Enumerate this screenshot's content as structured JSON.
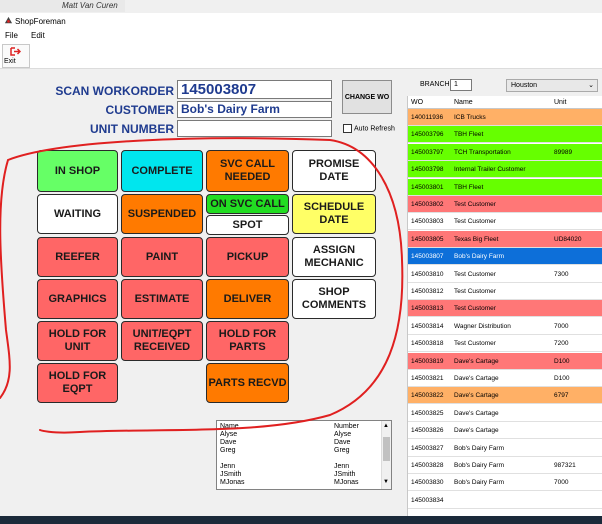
{
  "top_name": "Matt Van Curen",
  "app_title": "ShopForeman",
  "menu": [
    "File",
    "Edit"
  ],
  "toolbar": {
    "exit_label": "Exit"
  },
  "form": {
    "workorder_label": "SCAN WORKORDER",
    "workorder_value": "145003807",
    "customer_label": "CUSTOMER",
    "customer_value": "Bob's Dairy Farm",
    "unit_label": "UNIT NUMBER",
    "unit_value": "",
    "change_wo_label": "CHANGE WO",
    "auto_refresh_label": "Auto Refresh"
  },
  "buttons": {
    "in_shop": "IN SHOP",
    "complete": "COMPLETE",
    "svc_call_needed": "SVC CALL NEEDED",
    "promise_date": "PROMISE DATE",
    "waiting": "WAITING",
    "suspended": "SUSPENDED",
    "on_svc_call": "ON SVC CALL",
    "spot": "SPOT",
    "schedule_date": "SCHEDULE DATE",
    "reefer": "REEFER",
    "paint": "PAINT",
    "pickup": "PICKUP",
    "assign_mechanic": "ASSIGN MECHANIC",
    "graphics": "GRAPHICS",
    "estimate": "ESTIMATE",
    "deliver": "DELIVER",
    "shop_comments": "SHOP COMMENTS",
    "hold_for_unit": "HOLD FOR UNIT",
    "unit_eqpt_received": "UNIT/EQPT RECEIVED",
    "hold_for_parts": "HOLD FOR PARTS",
    "hold_for_eqpt": "HOLD FOR EQPT",
    "parts_recvd": "PARTS RECVD"
  },
  "user_list": {
    "headers": [
      "Name",
      "Number"
    ],
    "rows": [
      [
        "Alyse",
        "Alyse"
      ],
      [
        "Dave",
        "Dave"
      ],
      [
        "Greg",
        "Greg"
      ],
      [
        "",
        ""
      ],
      [
        "Jenn",
        "Jenn"
      ],
      [
        "JSmith",
        "JSmith"
      ],
      [
        "MJonas",
        "MJonas"
      ]
    ]
  },
  "branch": {
    "label": "BRANCH",
    "number": "1",
    "name": "Houston"
  },
  "grid": {
    "headers": [
      "WO",
      "Name",
      "Unit"
    ],
    "rows": [
      {
        "wo": "140011936",
        "name": "ICB Trucks",
        "unit": "",
        "color": "orange"
      },
      {
        "wo": "145003796",
        "name": "TBH Fleet",
        "unit": "",
        "color": "green"
      },
      {
        "wo": "145003797",
        "name": "TCH Transportation",
        "unit": "89989",
        "color": "green"
      },
      {
        "wo": "145003798",
        "name": "Internal Trailer Customer",
        "unit": "",
        "color": "green"
      },
      {
        "wo": "145003801",
        "name": "TBH Fleet",
        "unit": "",
        "color": "green"
      },
      {
        "wo": "145003802",
        "name": "Test Customer",
        "unit": "",
        "color": "pink"
      },
      {
        "wo": "145003803",
        "name": "Test Customer",
        "unit": "",
        "color": "white"
      },
      {
        "wo": "145003805",
        "name": "Texas Big Fleet",
        "unit": "UD84020",
        "color": "pink"
      },
      {
        "wo": "145003807",
        "name": "Bob's Dairy Farm",
        "unit": "",
        "color": "blue"
      },
      {
        "wo": "145003810",
        "name": "Test Customer",
        "unit": "7300",
        "color": "white"
      },
      {
        "wo": "145003812",
        "name": "Test Customer",
        "unit": "",
        "color": "white"
      },
      {
        "wo": "145003813",
        "name": "Test Customer",
        "unit": "",
        "color": "pink"
      },
      {
        "wo": "145003814",
        "name": "Wagner Distribution",
        "unit": "7000",
        "color": "white"
      },
      {
        "wo": "145003818",
        "name": "Test Customer",
        "unit": "7200",
        "color": "white"
      },
      {
        "wo": "145003819",
        "name": "Dave's Cartage",
        "unit": "D100",
        "color": "pink"
      },
      {
        "wo": "145003821",
        "name": "Dave's Cartage",
        "unit": "D100",
        "color": "white"
      },
      {
        "wo": "145003822",
        "name": "Dave's Cartage",
        "unit": "6797",
        "color": "orange"
      },
      {
        "wo": "145003825",
        "name": "Dave's Cartage",
        "unit": "",
        "color": "white"
      },
      {
        "wo": "145003826",
        "name": "Dave's Cartage",
        "unit": "",
        "color": "white"
      },
      {
        "wo": "145003827",
        "name": "Bob's Dairy Farm",
        "unit": "",
        "color": "white"
      },
      {
        "wo": "145003828",
        "name": "Bob's Dairy Farm",
        "unit": "987321",
        "color": "white"
      },
      {
        "wo": "145003830",
        "name": "Bob's Dairy Farm",
        "unit": "7000",
        "color": "white"
      },
      {
        "wo": "145003834",
        "name": "",
        "unit": "",
        "color": "white"
      }
    ]
  },
  "colors": {
    "label_blue": "#1f3b8f",
    "selected_row": "#0d6fd9",
    "annotation_red": "#e02020"
  }
}
